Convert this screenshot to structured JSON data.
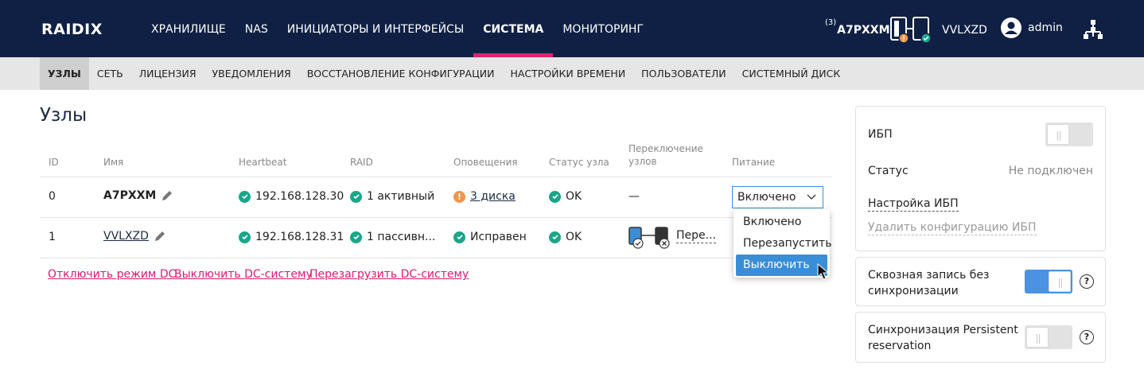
{
  "brand": {
    "logo_text": "RAIDIX"
  },
  "nav": {
    "items": [
      "ХРАНИЛИЩЕ",
      "NAS",
      "ИНИЦИАТОРЫ И ИНТЕРФЕЙСЫ",
      "СИСТЕМА",
      "МОНИТОРИНГ"
    ],
    "active": "СИСТЕМА"
  },
  "header": {
    "cluster_count": "(3)",
    "node1": "A7PXXM",
    "node2": "VVLXZD",
    "user": "admin",
    "node1_status_color": "#f0954a",
    "node2_status_color": "#1aa689",
    "accent_color": "#e0216e"
  },
  "subnav": {
    "items": [
      "УЗЛЫ",
      "СЕТЬ",
      "ЛИЦЕНЗИЯ",
      "УВЕДОМЛЕНИЯ",
      "ВОССТАНОВЛЕНИЕ КОНФИГУРАЦИИ",
      "НАСТРОЙКИ ВРЕМЕНИ",
      "ПОЛЬЗОВАТЕЛИ",
      "СИСТЕМНЫЙ ДИСК"
    ],
    "active": "УЗЛЫ"
  },
  "page": {
    "title": "Узлы"
  },
  "table": {
    "headers": {
      "id": "ID",
      "name": "Имя",
      "heartbeat": "Heartbeat",
      "raid": "RAID",
      "alerts": "Оповещения",
      "status": "Статус узла",
      "switch_line1": "Переключение",
      "switch_line2": "узлов",
      "power": "Питание"
    },
    "rows": [
      {
        "id": "0",
        "name": "A7PXXM",
        "heartbeat": "192.168.128.30",
        "raid": "1 активный",
        "alerts": "3 диска",
        "status": "OK",
        "switch": "—",
        "power": "Включено"
      },
      {
        "id": "1",
        "name": "VVLXZD",
        "heartbeat": "192.168.128.31",
        "raid": "1 пассивн...",
        "alerts": "Исправен",
        "status": "OK",
        "switch": "Пере..."
      }
    ]
  },
  "dc_actions": [
    "Отключить режим DC",
    "Выключить DC-систему",
    "Перезагрузить DC-систему"
  ],
  "power_menu": {
    "options": [
      "Включено",
      "Перезапустить",
      "Выключить"
    ],
    "highlighted": "Выключить"
  },
  "ups_panel": {
    "ups_label": "ИБП",
    "ups_enabled": false,
    "status_label": "Статус",
    "status_value": "Не подключен",
    "configure_link": "Настройка ИБП",
    "delete_link": "Удалить конфигурацию ИБП"
  },
  "write_through": {
    "label_line1": "Сквозная запись без",
    "label_line2": "синхронизации",
    "enabled": true,
    "help": "?"
  },
  "persistent_sync": {
    "label_line1": "Синхронизация Persistent",
    "label_line2": "reservation",
    "enabled": false,
    "help": "?"
  }
}
